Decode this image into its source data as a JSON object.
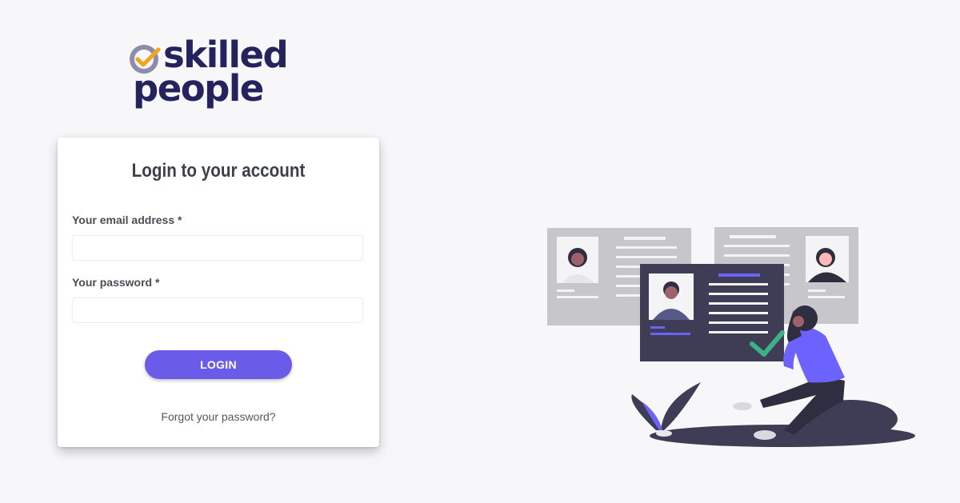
{
  "brand": {
    "logo_top": "skilled",
    "logo_bottom": "people",
    "colors": {
      "navy": "#25235e",
      "accent_orange": "#f2a51a",
      "ring_gray": "#8e8ca8"
    }
  },
  "login_card": {
    "title": "Login to your account",
    "email_label": "Your email address *",
    "email_value": "",
    "password_label": "Your password *",
    "password_value": "",
    "login_button": "LOGIN",
    "forgot_link": "Forgot your password?"
  },
  "theme": {
    "primary": "#6a5ce8",
    "background": "#f7f7f9",
    "card_background": "#ffffff",
    "check_green": "#3db184"
  },
  "illustration": {
    "icon": "recruiter-reviewing-profiles-illustration"
  }
}
